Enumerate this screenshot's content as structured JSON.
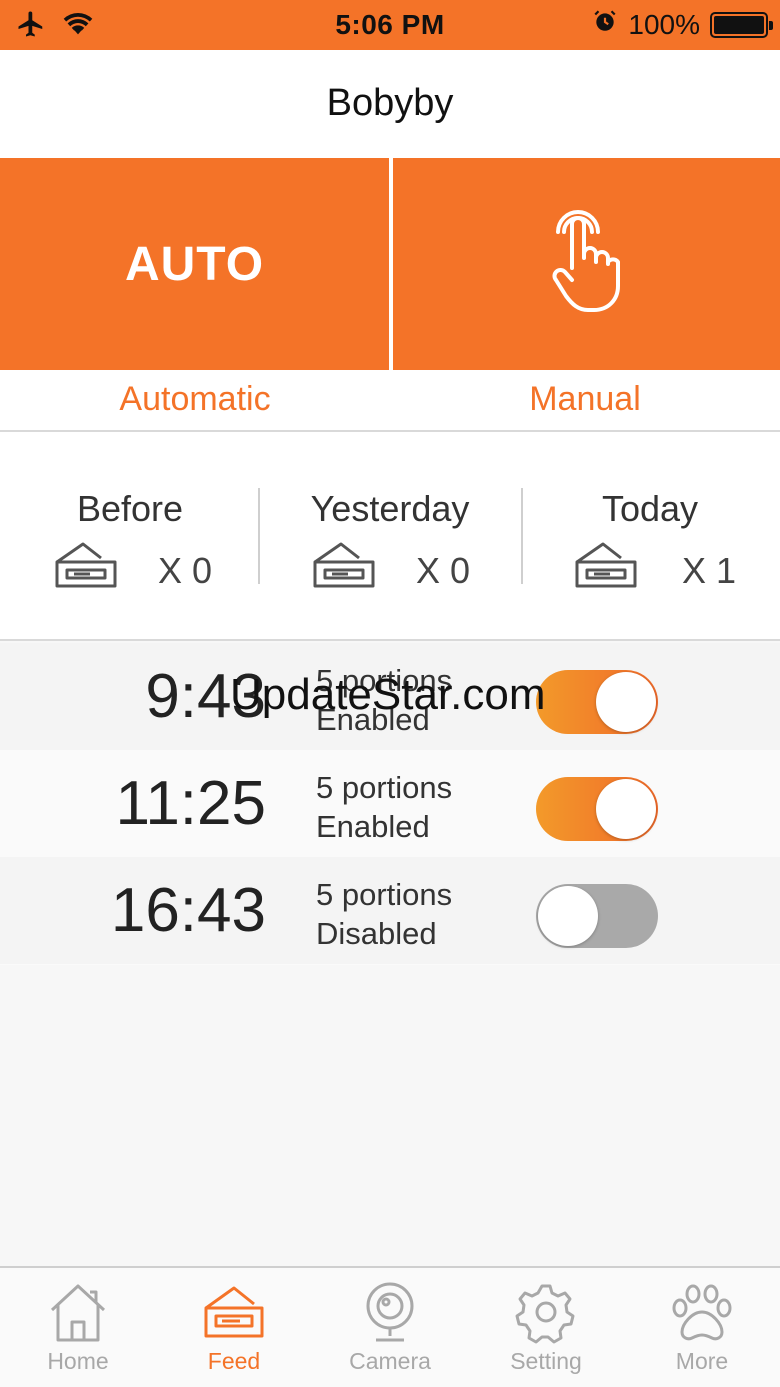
{
  "status_bar": {
    "time": "5:06 PM",
    "battery": "100%",
    "icons": [
      "airplane-icon",
      "wifi-icon",
      "alarm-icon",
      "battery-icon"
    ]
  },
  "nav": {
    "title": "Bobyby"
  },
  "modes": {
    "auto_tile_text": "AUTO",
    "automatic_label": "Automatic",
    "manual_label": "Manual",
    "accent_color": "#f47328"
  },
  "stats": [
    {
      "label": "Before",
      "count": "X 0"
    },
    {
      "label": "Yesterday",
      "count": "X 0"
    },
    {
      "label": "Today",
      "count": "X 1"
    }
  ],
  "schedules": [
    {
      "time": "9:43",
      "portions": "5 portions",
      "status": "Enabled",
      "enabled": true
    },
    {
      "time": "11:25",
      "portions": "5 portions",
      "status": "Enabled",
      "enabled": true
    },
    {
      "time": "16:43",
      "portions": "5 portions",
      "status": "Disabled",
      "enabled": false
    }
  ],
  "watermark": "UpdateStar.com",
  "tabs": [
    {
      "label": "Home",
      "icon": "house-icon",
      "active": false
    },
    {
      "label": "Feed",
      "icon": "feeder-icon",
      "active": true
    },
    {
      "label": "Camera",
      "icon": "camera-icon",
      "active": false
    },
    {
      "label": "Setting",
      "icon": "gear-icon",
      "active": false
    },
    {
      "label": "More",
      "icon": "paw-icon",
      "active": false
    }
  ]
}
